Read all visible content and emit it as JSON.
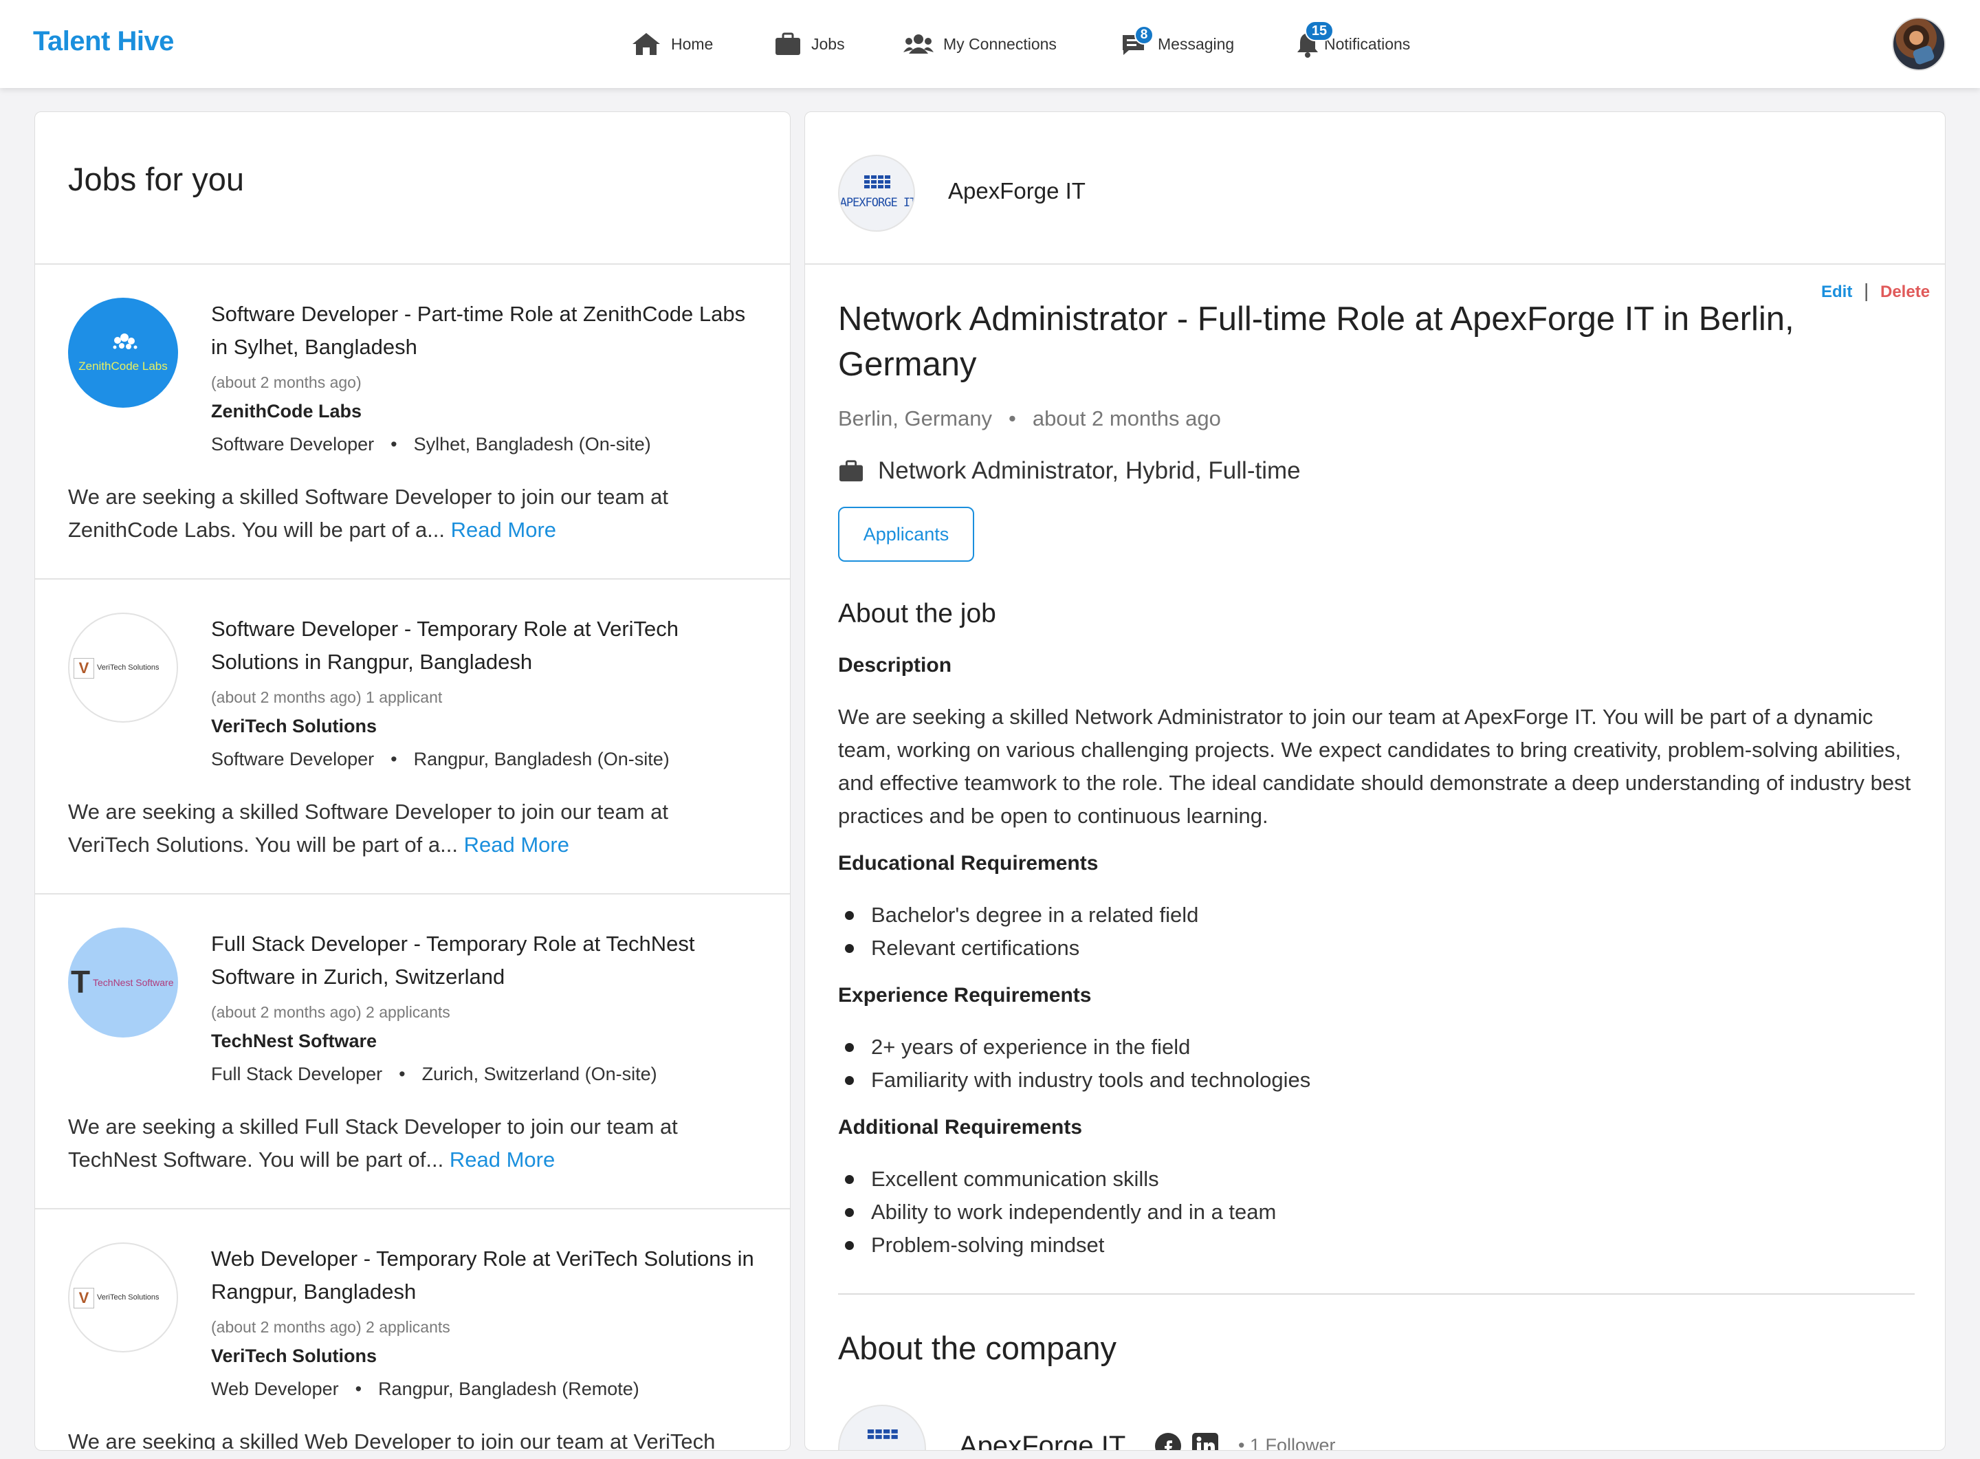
{
  "brand": "Talent Hive",
  "nav": {
    "home": "Home",
    "jobs": "Jobs",
    "connections": "My Connections",
    "messaging": "Messaging",
    "messaging_badge": "8",
    "notifications": "Notifications",
    "notifications_badge": "15"
  },
  "left": {
    "heading": "Jobs for you",
    "jobs": [
      {
        "title": "Software Developer - Part-time Role at ZenithCode Labs in Sylhet, Bangladesh",
        "meta": "(about 2 months ago)",
        "company": "ZenithCode Labs",
        "role": "Software Developer",
        "location": "Sylhet, Bangladesh (On-site)",
        "desc": "We are seeking a skilled Software Developer to join our team at ZenithCode Labs. You will be part of a...",
        "logo_text": "ZenithCode Labs"
      },
      {
        "title": "Software Developer - Temporary Role at VeriTech Solutions in Rangpur, Bangladesh",
        "meta": "(about 2 months ago)   1 applicant",
        "company": "VeriTech Solutions",
        "role": "Software Developer",
        "location": "Rangpur, Bangladesh (On-site)",
        "desc": "We are seeking a skilled Software Developer to join our team at VeriTech Solutions. You will be part of a...",
        "logo_text": "VeriTech Solutions"
      },
      {
        "title": "Full Stack Developer - Temporary Role at TechNest Software in Zurich, Switzerland",
        "meta": "(about 2 months ago)   2 applicants",
        "company": "TechNest Software",
        "role": "Full Stack Developer",
        "location": "Zurich, Switzerland (On-site)",
        "desc": "We are seeking a skilled Full Stack Developer to join our team at TechNest Software. You will be part of...",
        "logo_text": "TechNest Software"
      },
      {
        "title": "Web Developer - Temporary Role at VeriTech Solutions in Rangpur, Bangladesh",
        "meta": "(about 2 months ago)   2 applicants",
        "company": "VeriTech Solutions",
        "role": "Web Developer",
        "location": "Rangpur, Bangladesh (Remote)",
        "desc": "We are seeking a skilled Web Developer to join our team at VeriTech",
        "logo_text": "VeriTech Solutions"
      }
    ],
    "read_more": "Read More",
    "bullet_sep": "•"
  },
  "detail": {
    "company": "ApexForge IT",
    "logo_text": "APEXFORGE IT",
    "edit": "Edit",
    "separator": "|",
    "delete": "Delete",
    "title": "Network Administrator - Full-time Role at ApexForge IT in Berlin, Germany",
    "location": "Berlin, Germany",
    "posted": "about 2 months ago",
    "type": "Network Administrator, Hybrid, Full-time",
    "applicants_btn": "Applicants",
    "about_job": "About the job",
    "description_label": "Description",
    "description": "We are seeking a skilled Network Administrator to join our team at ApexForge IT. You will be part of a dynamic team, working on various challenging projects. We expect candidates to bring creativity, problem-solving abilities, and effective teamwork to the role. The ideal candidate should demonstrate a deep understanding of industry best practices and be open to continuous learning.",
    "edu_label": "Educational Requirements",
    "edu": [
      "Bachelor's degree in a related field",
      "Relevant certifications"
    ],
    "exp_label": "Experience Requirements",
    "exp": [
      "2+ years of experience in the field",
      "Familiarity with industry tools and technologies"
    ],
    "add_label": "Additional Requirements",
    "add": [
      "Excellent communication skills",
      "Ability to work independently and in a team",
      "Problem-solving mindset"
    ],
    "about_company": "About the company",
    "followers": "1 Follower"
  },
  "colors": {
    "accent": "#1a8fdd",
    "delete": "#e05a5a",
    "badge": "#1478c8"
  }
}
